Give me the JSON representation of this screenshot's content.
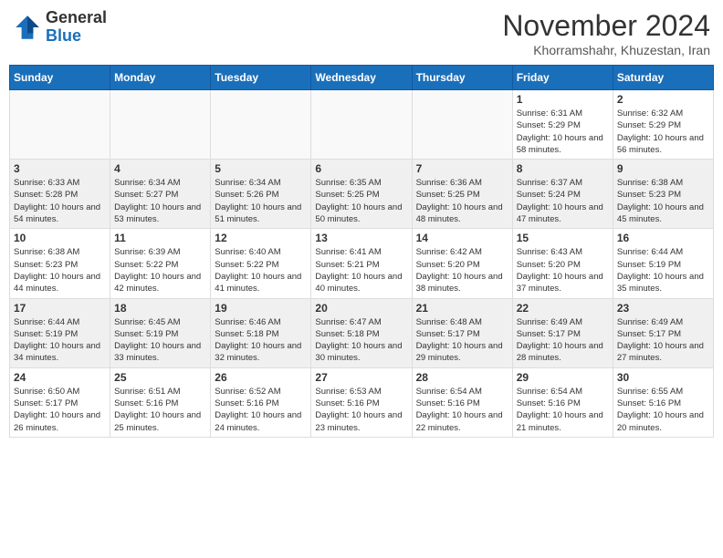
{
  "logo": {
    "text_general": "General",
    "text_blue": "Blue"
  },
  "header": {
    "month": "November 2024",
    "location": "Khorramshahr, Khuzestan, Iran"
  },
  "weekdays": [
    "Sunday",
    "Monday",
    "Tuesday",
    "Wednesday",
    "Thursday",
    "Friday",
    "Saturday"
  ],
  "weeks": [
    [
      {
        "day": "",
        "info": ""
      },
      {
        "day": "",
        "info": ""
      },
      {
        "day": "",
        "info": ""
      },
      {
        "day": "",
        "info": ""
      },
      {
        "day": "",
        "info": ""
      },
      {
        "day": "1",
        "info": "Sunrise: 6:31 AM\nSunset: 5:29 PM\nDaylight: 10 hours and 58 minutes."
      },
      {
        "day": "2",
        "info": "Sunrise: 6:32 AM\nSunset: 5:29 PM\nDaylight: 10 hours and 56 minutes."
      }
    ],
    [
      {
        "day": "3",
        "info": "Sunrise: 6:33 AM\nSunset: 5:28 PM\nDaylight: 10 hours and 54 minutes."
      },
      {
        "day": "4",
        "info": "Sunrise: 6:34 AM\nSunset: 5:27 PM\nDaylight: 10 hours and 53 minutes."
      },
      {
        "day": "5",
        "info": "Sunrise: 6:34 AM\nSunset: 5:26 PM\nDaylight: 10 hours and 51 minutes."
      },
      {
        "day": "6",
        "info": "Sunrise: 6:35 AM\nSunset: 5:25 PM\nDaylight: 10 hours and 50 minutes."
      },
      {
        "day": "7",
        "info": "Sunrise: 6:36 AM\nSunset: 5:25 PM\nDaylight: 10 hours and 48 minutes."
      },
      {
        "day": "8",
        "info": "Sunrise: 6:37 AM\nSunset: 5:24 PM\nDaylight: 10 hours and 47 minutes."
      },
      {
        "day": "9",
        "info": "Sunrise: 6:38 AM\nSunset: 5:23 PM\nDaylight: 10 hours and 45 minutes."
      }
    ],
    [
      {
        "day": "10",
        "info": "Sunrise: 6:38 AM\nSunset: 5:23 PM\nDaylight: 10 hours and 44 minutes."
      },
      {
        "day": "11",
        "info": "Sunrise: 6:39 AM\nSunset: 5:22 PM\nDaylight: 10 hours and 42 minutes."
      },
      {
        "day": "12",
        "info": "Sunrise: 6:40 AM\nSunset: 5:22 PM\nDaylight: 10 hours and 41 minutes."
      },
      {
        "day": "13",
        "info": "Sunrise: 6:41 AM\nSunset: 5:21 PM\nDaylight: 10 hours and 40 minutes."
      },
      {
        "day": "14",
        "info": "Sunrise: 6:42 AM\nSunset: 5:20 PM\nDaylight: 10 hours and 38 minutes."
      },
      {
        "day": "15",
        "info": "Sunrise: 6:43 AM\nSunset: 5:20 PM\nDaylight: 10 hours and 37 minutes."
      },
      {
        "day": "16",
        "info": "Sunrise: 6:44 AM\nSunset: 5:19 PM\nDaylight: 10 hours and 35 minutes."
      }
    ],
    [
      {
        "day": "17",
        "info": "Sunrise: 6:44 AM\nSunset: 5:19 PM\nDaylight: 10 hours and 34 minutes."
      },
      {
        "day": "18",
        "info": "Sunrise: 6:45 AM\nSunset: 5:19 PM\nDaylight: 10 hours and 33 minutes."
      },
      {
        "day": "19",
        "info": "Sunrise: 6:46 AM\nSunset: 5:18 PM\nDaylight: 10 hours and 32 minutes."
      },
      {
        "day": "20",
        "info": "Sunrise: 6:47 AM\nSunset: 5:18 PM\nDaylight: 10 hours and 30 minutes."
      },
      {
        "day": "21",
        "info": "Sunrise: 6:48 AM\nSunset: 5:17 PM\nDaylight: 10 hours and 29 minutes."
      },
      {
        "day": "22",
        "info": "Sunrise: 6:49 AM\nSunset: 5:17 PM\nDaylight: 10 hours and 28 minutes."
      },
      {
        "day": "23",
        "info": "Sunrise: 6:49 AM\nSunset: 5:17 PM\nDaylight: 10 hours and 27 minutes."
      }
    ],
    [
      {
        "day": "24",
        "info": "Sunrise: 6:50 AM\nSunset: 5:17 PM\nDaylight: 10 hours and 26 minutes."
      },
      {
        "day": "25",
        "info": "Sunrise: 6:51 AM\nSunset: 5:16 PM\nDaylight: 10 hours and 25 minutes."
      },
      {
        "day": "26",
        "info": "Sunrise: 6:52 AM\nSunset: 5:16 PM\nDaylight: 10 hours and 24 minutes."
      },
      {
        "day": "27",
        "info": "Sunrise: 6:53 AM\nSunset: 5:16 PM\nDaylight: 10 hours and 23 minutes."
      },
      {
        "day": "28",
        "info": "Sunrise: 6:54 AM\nSunset: 5:16 PM\nDaylight: 10 hours and 22 minutes."
      },
      {
        "day": "29",
        "info": "Sunrise: 6:54 AM\nSunset: 5:16 PM\nDaylight: 10 hours and 21 minutes."
      },
      {
        "day": "30",
        "info": "Sunrise: 6:55 AM\nSunset: 5:16 PM\nDaylight: 10 hours and 20 minutes."
      }
    ]
  ]
}
